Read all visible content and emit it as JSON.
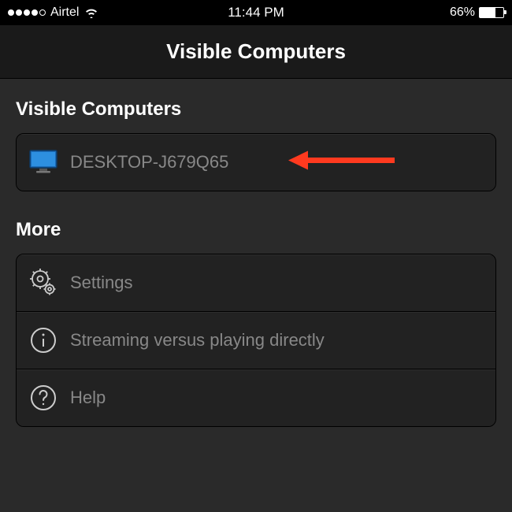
{
  "status_bar": {
    "carrier": "Airtel",
    "time": "11:44 PM",
    "battery_percent": "66%"
  },
  "nav": {
    "title": "Visible Computers"
  },
  "sections": {
    "visible_computers": {
      "header": "Visible Computers",
      "items": [
        {
          "label": "DESKTOP-J679Q65"
        }
      ]
    },
    "more": {
      "header": "More",
      "items": [
        {
          "label": "Settings"
        },
        {
          "label": "Streaming versus playing directly"
        },
        {
          "label": "Help"
        }
      ]
    }
  },
  "annotation": {
    "arrow_color": "#ff3a1f"
  }
}
